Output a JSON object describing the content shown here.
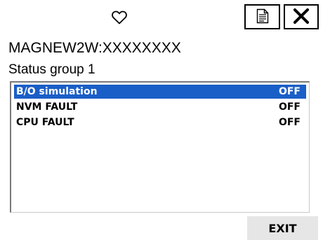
{
  "header": {
    "icons": {
      "heart": "heart-outline-icon",
      "document": "document-icon",
      "close": "close-icon"
    },
    "device_title": "MAGNEW2W:XXXXXXXX",
    "group_title": "Status group 1"
  },
  "status_list": {
    "items": [
      {
        "label": "B/O simulation",
        "value": "OFF",
        "selected": true
      },
      {
        "label": "NVM FAULT",
        "value": "OFF",
        "selected": false
      },
      {
        "label": "CPU FAULT",
        "value": "OFF",
        "selected": false
      }
    ]
  },
  "footer": {
    "exit_label": "EXIT"
  },
  "colors": {
    "selection": "#1a5ec7",
    "button_bg": "#e6e6e6"
  }
}
